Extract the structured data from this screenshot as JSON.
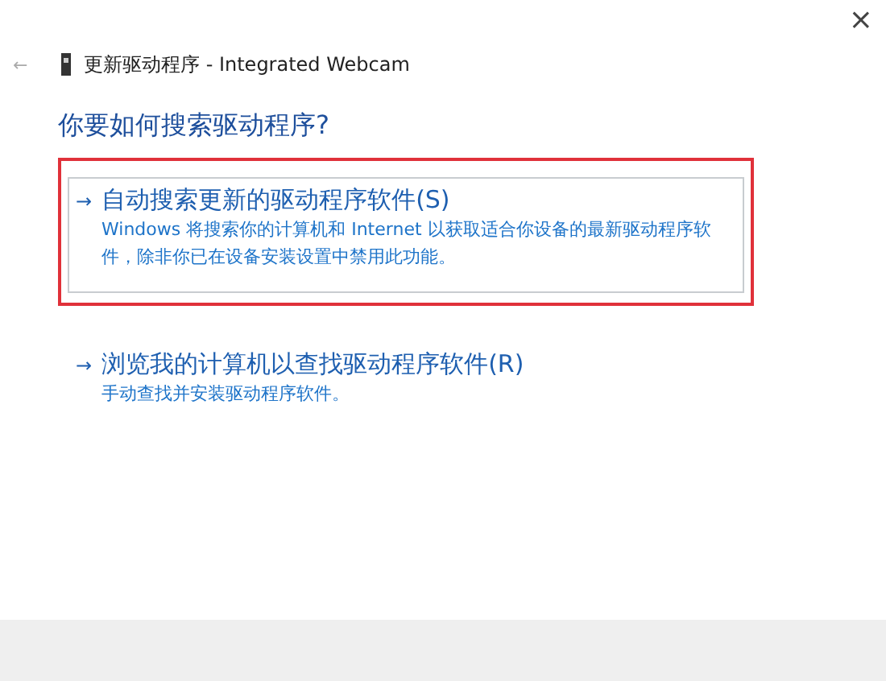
{
  "window": {
    "close": "×",
    "back": "←",
    "title": "更新驱动程序 - Integrated Webcam"
  },
  "heading": "你要如何搜索驱动程序?",
  "options": [
    {
      "arrow": "→",
      "title": "自动搜索更新的驱动程序软件(S)",
      "description": "Windows 将搜索你的计算机和 Internet 以获取适合你设备的最新驱动程序软件，除非你已在设备安装设置中禁用此功能。",
      "selected": true
    },
    {
      "arrow": "→",
      "title": "浏览我的计算机以查找驱动程序软件(R)",
      "description": "手动查找并安装驱动程序软件。",
      "selected": false
    }
  ]
}
